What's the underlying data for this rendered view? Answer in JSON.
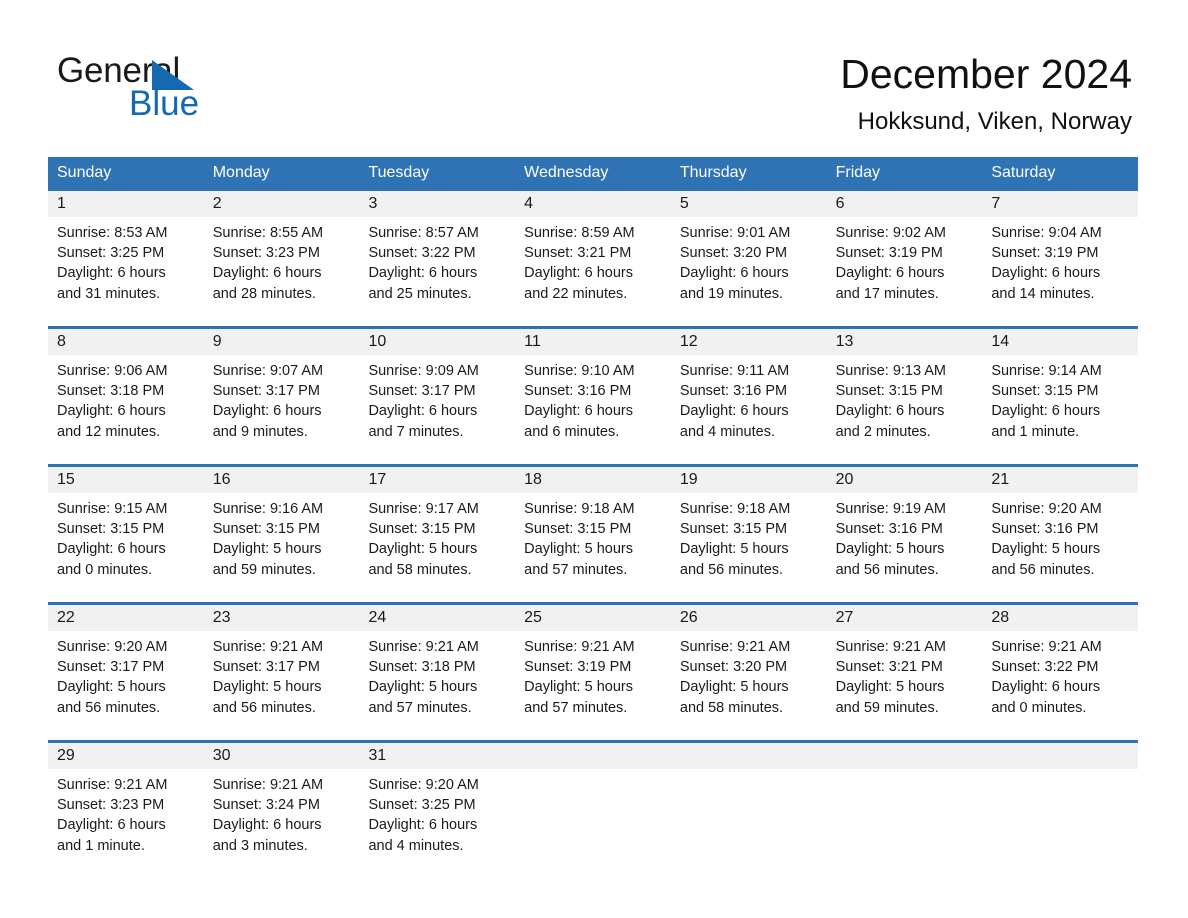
{
  "brand": {
    "name_part1": "General",
    "name_part2": "Blue",
    "triangle_color": "#1569b0"
  },
  "header": {
    "title": "December 2024",
    "subtitle": "Hokksund, Viken, Norway",
    "accent_color": "#3073b5",
    "number_strip_color": "#f1f1f1"
  },
  "weekday_headers": [
    "Sunday",
    "Monday",
    "Tuesday",
    "Wednesday",
    "Thursday",
    "Friday",
    "Saturday"
  ],
  "weeks": [
    [
      {
        "day": "1",
        "sunrise": "Sunrise: 8:53 AM",
        "sunset": "Sunset: 3:25 PM",
        "daylight1": "Daylight: 6 hours",
        "daylight2": "and 31 minutes."
      },
      {
        "day": "2",
        "sunrise": "Sunrise: 8:55 AM",
        "sunset": "Sunset: 3:23 PM",
        "daylight1": "Daylight: 6 hours",
        "daylight2": "and 28 minutes."
      },
      {
        "day": "3",
        "sunrise": "Sunrise: 8:57 AM",
        "sunset": "Sunset: 3:22 PM",
        "daylight1": "Daylight: 6 hours",
        "daylight2": "and 25 minutes."
      },
      {
        "day": "4",
        "sunrise": "Sunrise: 8:59 AM",
        "sunset": "Sunset: 3:21 PM",
        "daylight1": "Daylight: 6 hours",
        "daylight2": "and 22 minutes."
      },
      {
        "day": "5",
        "sunrise": "Sunrise: 9:01 AM",
        "sunset": "Sunset: 3:20 PM",
        "daylight1": "Daylight: 6 hours",
        "daylight2": "and 19 minutes."
      },
      {
        "day": "6",
        "sunrise": "Sunrise: 9:02 AM",
        "sunset": "Sunset: 3:19 PM",
        "daylight1": "Daylight: 6 hours",
        "daylight2": "and 17 minutes."
      },
      {
        "day": "7",
        "sunrise": "Sunrise: 9:04 AM",
        "sunset": "Sunset: 3:19 PM",
        "daylight1": "Daylight: 6 hours",
        "daylight2": "and 14 minutes."
      }
    ],
    [
      {
        "day": "8",
        "sunrise": "Sunrise: 9:06 AM",
        "sunset": "Sunset: 3:18 PM",
        "daylight1": "Daylight: 6 hours",
        "daylight2": "and 12 minutes."
      },
      {
        "day": "9",
        "sunrise": "Sunrise: 9:07 AM",
        "sunset": "Sunset: 3:17 PM",
        "daylight1": "Daylight: 6 hours",
        "daylight2": "and 9 minutes."
      },
      {
        "day": "10",
        "sunrise": "Sunrise: 9:09 AM",
        "sunset": "Sunset: 3:17 PM",
        "daylight1": "Daylight: 6 hours",
        "daylight2": "and 7 minutes."
      },
      {
        "day": "11",
        "sunrise": "Sunrise: 9:10 AM",
        "sunset": "Sunset: 3:16 PM",
        "daylight1": "Daylight: 6 hours",
        "daylight2": "and 6 minutes."
      },
      {
        "day": "12",
        "sunrise": "Sunrise: 9:11 AM",
        "sunset": "Sunset: 3:16 PM",
        "daylight1": "Daylight: 6 hours",
        "daylight2": "and 4 minutes."
      },
      {
        "day": "13",
        "sunrise": "Sunrise: 9:13 AM",
        "sunset": "Sunset: 3:15 PM",
        "daylight1": "Daylight: 6 hours",
        "daylight2": "and 2 minutes."
      },
      {
        "day": "14",
        "sunrise": "Sunrise: 9:14 AM",
        "sunset": "Sunset: 3:15 PM",
        "daylight1": "Daylight: 6 hours",
        "daylight2": "and 1 minute."
      }
    ],
    [
      {
        "day": "15",
        "sunrise": "Sunrise: 9:15 AM",
        "sunset": "Sunset: 3:15 PM",
        "daylight1": "Daylight: 6 hours",
        "daylight2": "and 0 minutes."
      },
      {
        "day": "16",
        "sunrise": "Sunrise: 9:16 AM",
        "sunset": "Sunset: 3:15 PM",
        "daylight1": "Daylight: 5 hours",
        "daylight2": "and 59 minutes."
      },
      {
        "day": "17",
        "sunrise": "Sunrise: 9:17 AM",
        "sunset": "Sunset: 3:15 PM",
        "daylight1": "Daylight: 5 hours",
        "daylight2": "and 58 minutes."
      },
      {
        "day": "18",
        "sunrise": "Sunrise: 9:18 AM",
        "sunset": "Sunset: 3:15 PM",
        "daylight1": "Daylight: 5 hours",
        "daylight2": "and 57 minutes."
      },
      {
        "day": "19",
        "sunrise": "Sunrise: 9:18 AM",
        "sunset": "Sunset: 3:15 PM",
        "daylight1": "Daylight: 5 hours",
        "daylight2": "and 56 minutes."
      },
      {
        "day": "20",
        "sunrise": "Sunrise: 9:19 AM",
        "sunset": "Sunset: 3:16 PM",
        "daylight1": "Daylight: 5 hours",
        "daylight2": "and 56 minutes."
      },
      {
        "day": "21",
        "sunrise": "Sunrise: 9:20 AM",
        "sunset": "Sunset: 3:16 PM",
        "daylight1": "Daylight: 5 hours",
        "daylight2": "and 56 minutes."
      }
    ],
    [
      {
        "day": "22",
        "sunrise": "Sunrise: 9:20 AM",
        "sunset": "Sunset: 3:17 PM",
        "daylight1": "Daylight: 5 hours",
        "daylight2": "and 56 minutes."
      },
      {
        "day": "23",
        "sunrise": "Sunrise: 9:21 AM",
        "sunset": "Sunset: 3:17 PM",
        "daylight1": "Daylight: 5 hours",
        "daylight2": "and 56 minutes."
      },
      {
        "day": "24",
        "sunrise": "Sunrise: 9:21 AM",
        "sunset": "Sunset: 3:18 PM",
        "daylight1": "Daylight: 5 hours",
        "daylight2": "and 57 minutes."
      },
      {
        "day": "25",
        "sunrise": "Sunrise: 9:21 AM",
        "sunset": "Sunset: 3:19 PM",
        "daylight1": "Daylight: 5 hours",
        "daylight2": "and 57 minutes."
      },
      {
        "day": "26",
        "sunrise": "Sunrise: 9:21 AM",
        "sunset": "Sunset: 3:20 PM",
        "daylight1": "Daylight: 5 hours",
        "daylight2": "and 58 minutes."
      },
      {
        "day": "27",
        "sunrise": "Sunrise: 9:21 AM",
        "sunset": "Sunset: 3:21 PM",
        "daylight1": "Daylight: 5 hours",
        "daylight2": "and 59 minutes."
      },
      {
        "day": "28",
        "sunrise": "Sunrise: 9:21 AM",
        "sunset": "Sunset: 3:22 PM",
        "daylight1": "Daylight: 6 hours",
        "daylight2": "and 0 minutes."
      }
    ],
    [
      {
        "day": "29",
        "sunrise": "Sunrise: 9:21 AM",
        "sunset": "Sunset: 3:23 PM",
        "daylight1": "Daylight: 6 hours",
        "daylight2": "and 1 minute."
      },
      {
        "day": "30",
        "sunrise": "Sunrise: 9:21 AM",
        "sunset": "Sunset: 3:24 PM",
        "daylight1": "Daylight: 6 hours",
        "daylight2": "and 3 minutes."
      },
      {
        "day": "31",
        "sunrise": "Sunrise: 9:20 AM",
        "sunset": "Sunset: 3:25 PM",
        "daylight1": "Daylight: 6 hours",
        "daylight2": "and 4 minutes."
      },
      {
        "day": "",
        "sunrise": "",
        "sunset": "",
        "daylight1": "",
        "daylight2": ""
      },
      {
        "day": "",
        "sunrise": "",
        "sunset": "",
        "daylight1": "",
        "daylight2": ""
      },
      {
        "day": "",
        "sunrise": "",
        "sunset": "",
        "daylight1": "",
        "daylight2": ""
      },
      {
        "day": "",
        "sunrise": "",
        "sunset": "",
        "daylight1": "",
        "daylight2": ""
      }
    ]
  ]
}
